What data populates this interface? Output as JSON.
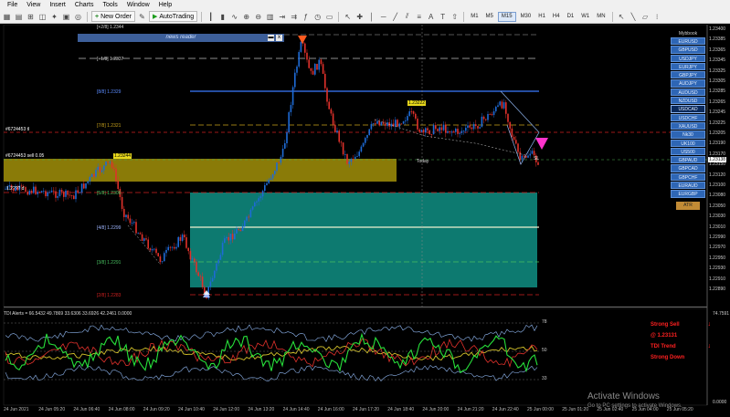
{
  "menu": [
    "File",
    "View",
    "Insert",
    "Charts",
    "Tools",
    "Window",
    "Help"
  ],
  "toolbar": {
    "new_order": "New Order",
    "autotrading": "AutoTrading",
    "timeframes": [
      "M1",
      "M5",
      "M15",
      "M30",
      "H1",
      "H4",
      "D1",
      "W1",
      "MN"
    ],
    "active_timeframe": "M15"
  },
  "news_panel": {
    "title": "news reader",
    "close_icon": "x"
  },
  "levels": {
    "l28p": "[+2/8]  1.2344",
    "l18p": "[+1/8]  1.2337",
    "l88": "[8/8]  1.2329",
    "l78": "[7/8]  1.2321",
    "l58": "[5/8]  1.2306",
    "l48": "[4/8]  1.2299",
    "l38": "[3/8]  1.2291",
    "l28": "[2/8]  1.2283",
    "ticket1": "#6724453 tl",
    "ticket2": "#6724453 sell 0.05",
    "ticket3": "1.2??? d",
    "box_label": "1.23244",
    "trade_label": "1.23222",
    "today": "Today",
    "stoploss": "SL"
  },
  "symbols_title": "Mybbook  ",
  "symbols": [
    "EURUSD",
    "GBPUSD",
    "USDJPY",
    "EURJPY",
    "GBPJPY",
    "AUDJPY",
    "AUDUSD",
    "NZDUSD",
    "USDCAD",
    "USDCHF",
    "XAUUSD",
    "Nk30",
    "UK100",
    "US500",
    "GBPAUD",
    "GBPCAD",
    "GBPCHF",
    "EURAUD",
    "EURGBP"
  ],
  "selected_symbol": "USDCAD",
  "atr_button": "ATR",
  "price_scale": [
    "1.23400",
    "1.23385",
    "1.23365",
    "1.23345",
    "1.23325",
    "1.23305",
    "1.23285",
    "1.23265",
    "1.23245",
    "1.23225",
    "1.23205",
    "1.23190",
    "1.23170",
    "1.23150",
    "1.23120",
    "1.23100",
    "1.23080",
    "1.23050",
    "1.23030",
    "1.23010",
    "1.22990",
    "1.22970",
    "1.22950",
    "1.22930",
    "1.22910",
    "1.22890"
  ],
  "current_price": "1.23138",
  "time_axis": [
    "24 Jun 2021",
    "24 Jun 05:20",
    "24 Jun 06:40",
    "24 Jun 08:00",
    "24 Jun 09:20",
    "24 Jun 10:40",
    "24 Jun 12:00",
    "24 Jun 13:20",
    "24 Jun 14:40",
    "24 Jun 16:00",
    "24 Jun 17:20",
    "24 Jun 18:40",
    "24 Jun 20:00",
    "24 Jun 21:20",
    "24 Jun 22:40",
    "25 Jun 00:00",
    "25 Jun 01:20",
    "25 Jun 02:40",
    "25 Jun 04:00",
    "25 Jun 05:20"
  ],
  "indicator": {
    "title": "TDI Alerts = 66.5432 49.7869 33.6306 33.6926 42.2461 0.0000",
    "levels": [
      "78",
      "50",
      "33"
    ],
    "scale_top": "74.7591",
    "scale_bottom": "0.0000",
    "signals": [
      "Strong Sell",
      "@ 1.23131",
      "TDI Trend",
      "Strong Down"
    ]
  },
  "watermark": {
    "line1": "Activate Windows",
    "line2": "Go to PC settings to activate Windows."
  },
  "colors": {
    "bull": "#1e6bd6",
    "bear": "#e0312b",
    "yellow_box": "#8a7b08",
    "teal_box": "#0d7a70",
    "blue_level": "#3a7bff",
    "red_level": "#d02020",
    "panel_blue": "#2e66b5"
  }
}
